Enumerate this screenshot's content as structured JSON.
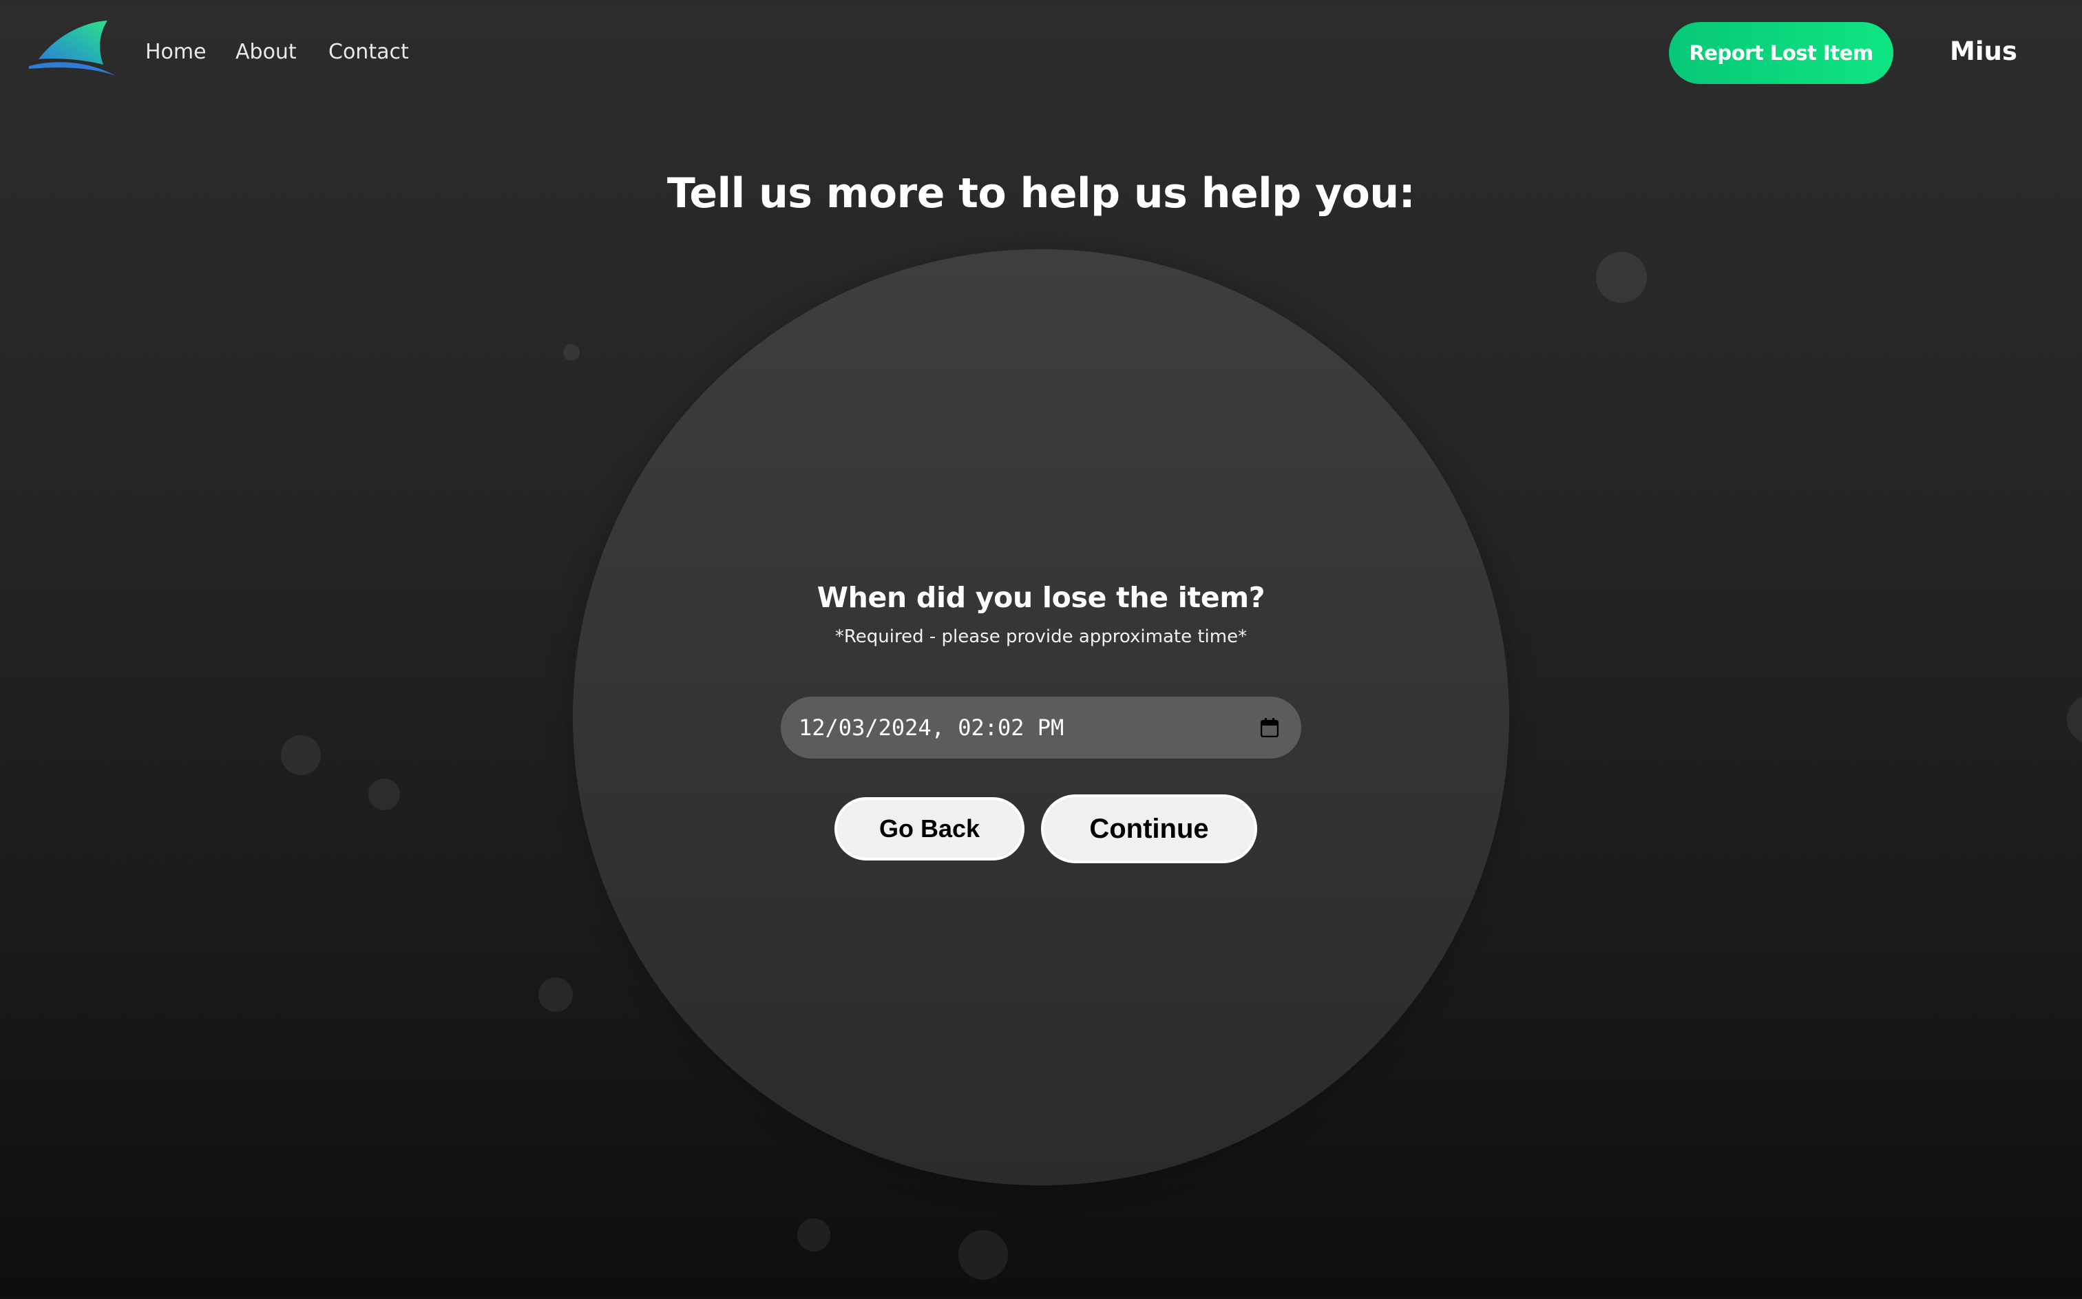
{
  "nav": {
    "logo": "shark-fin-logo",
    "links": [
      "Home",
      "About",
      "Contact"
    ],
    "report_button": "Report Lost Item",
    "username": "Mius",
    "accent_color": "#0fe582"
  },
  "main": {
    "title": "Tell us more to help us help you:",
    "question": "When did you lose the item?",
    "required_note": "*Required - please provide approximate time*",
    "datetime_value": "12/03/2024, 02:02 PM",
    "calendar_icon": "calendar-icon",
    "back_button": "Go Back",
    "continue_button": "Continue"
  }
}
